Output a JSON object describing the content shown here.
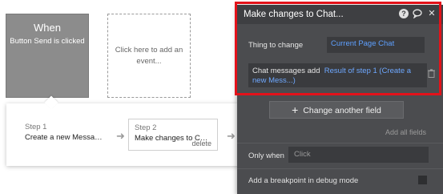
{
  "canvas": {
    "when": {
      "title": "When",
      "subtitle": "Button Send is clicked"
    },
    "add_event": {
      "text": "Click here to add an event..."
    },
    "steps": [
      {
        "num": "Step 1",
        "text": "Create a new Message..."
      },
      {
        "num": "Step 2",
        "text": "Make changes to Chat...",
        "delete": "delete"
      }
    ]
  },
  "panel": {
    "title": "Make changes to Chat...",
    "header_icons": [
      "help-icon",
      "comment-icon",
      "close-icon"
    ],
    "thing_to_change": {
      "label": "Thing to change",
      "value": "Current Page Chat"
    },
    "chat_messages": {
      "label": "Chat messages add",
      "value": "Result of step 1 (Create a new Mess...)"
    },
    "change_field_button": "Change another field",
    "add_all_fields": "Add all fields",
    "only_when": {
      "label": "Only when",
      "placeholder": "Click"
    },
    "breakpoint": {
      "label": "Add a breakpoint in debug mode"
    }
  },
  "colors": {
    "panel_bg": "#4b4c4f",
    "link_blue": "#6ea8ff",
    "highlight_red": "#e3121a"
  }
}
